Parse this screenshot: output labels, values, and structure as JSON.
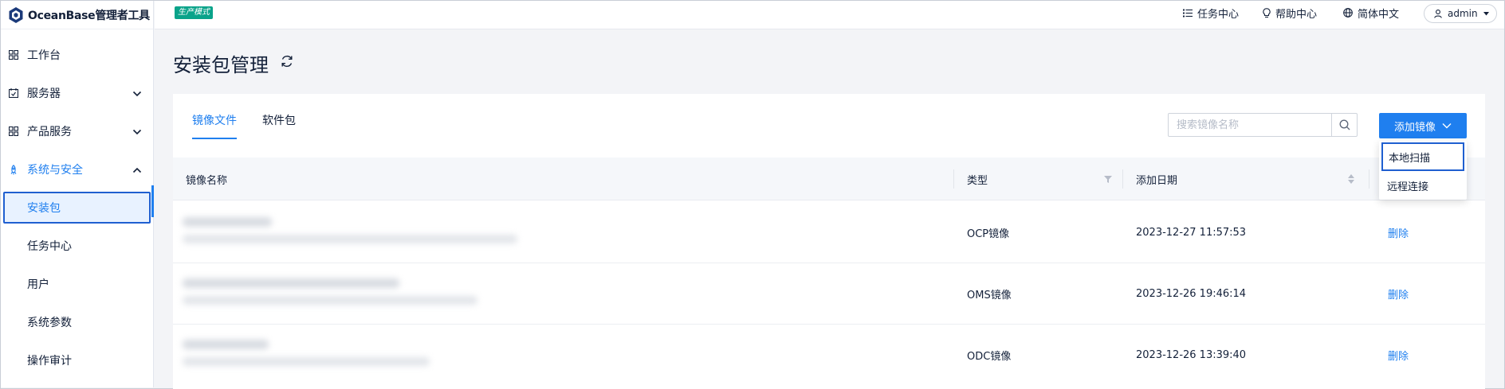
{
  "app": {
    "logo_text": "OceanBase管理者工具",
    "env_badge": "生产模式"
  },
  "header": {
    "links": [
      {
        "label": "任务中心",
        "icon": "list-icon"
      },
      {
        "label": "帮助中心",
        "icon": "bulb-icon"
      },
      {
        "label": "简体中文",
        "icon": "globe-icon"
      }
    ],
    "user": "admin"
  },
  "sidebar": {
    "items": [
      {
        "label": "工作台",
        "icon": "grid-icon"
      },
      {
        "label": "服务器",
        "icon": "server-check-icon"
      },
      {
        "label": "产品服务",
        "icon": "apps-icon"
      },
      {
        "label": "系统与安全",
        "icon": "rocket-icon"
      }
    ],
    "sub_items": [
      "安装包",
      "任务中心",
      "用户",
      "系统参数",
      "操作审计"
    ]
  },
  "page": {
    "title": "安装包管理"
  },
  "tabs": [
    "镜像文件",
    "软件包"
  ],
  "search": {
    "placeholder": "搜索镜像名称"
  },
  "add_button": {
    "label": "添加镜像"
  },
  "dropdown": {
    "items": [
      "本地扫描",
      "远程连接"
    ]
  },
  "table": {
    "headers": {
      "name": "镜像名称",
      "type": "类型",
      "date": "添加日期"
    },
    "rows": [
      {
        "type": "OCP镜像",
        "date": "2023-12-27 11:57:53",
        "action": "删除"
      },
      {
        "type": "OMS镜像",
        "date": "2023-12-26 19:46:14",
        "action": "删除"
      },
      {
        "type": "ODC镜像",
        "date": "2023-12-26 13:39:40",
        "action": "删除"
      }
    ]
  },
  "colors": {
    "accent": "#1f7fef",
    "badge": "#0aa38a",
    "text": "#132039"
  }
}
